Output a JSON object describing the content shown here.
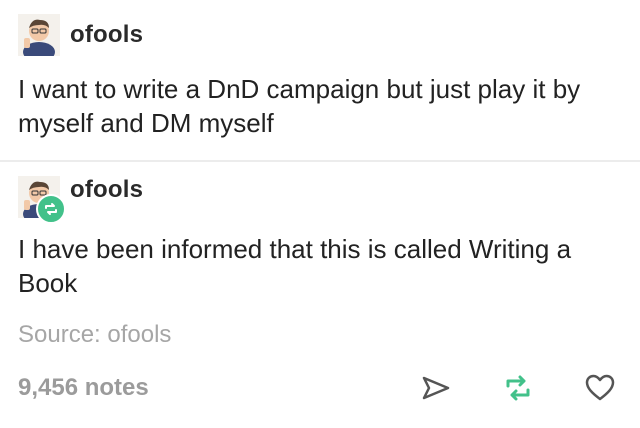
{
  "posts": [
    {
      "username": "ofools",
      "avatar_icon": "user-avatar",
      "text": "I want to write a DnD campaign but just play it by myself and DM myself"
    },
    {
      "username": "ofools",
      "avatar_icon": "user-avatar",
      "badge_icon": "reblog-icon",
      "text": "I have been informed that this is called Writing a Book"
    }
  ],
  "source": "Source: ofools",
  "footer": {
    "notes": "9,456 notes",
    "share_icon": "share-icon",
    "reblog_icon": "reblog-icon",
    "like_icon": "heart-icon"
  },
  "colors": {
    "text": "#222222",
    "muted": "#a6a6a6",
    "reblog_green": "#42c18a",
    "icon_gray": "#555555"
  }
}
